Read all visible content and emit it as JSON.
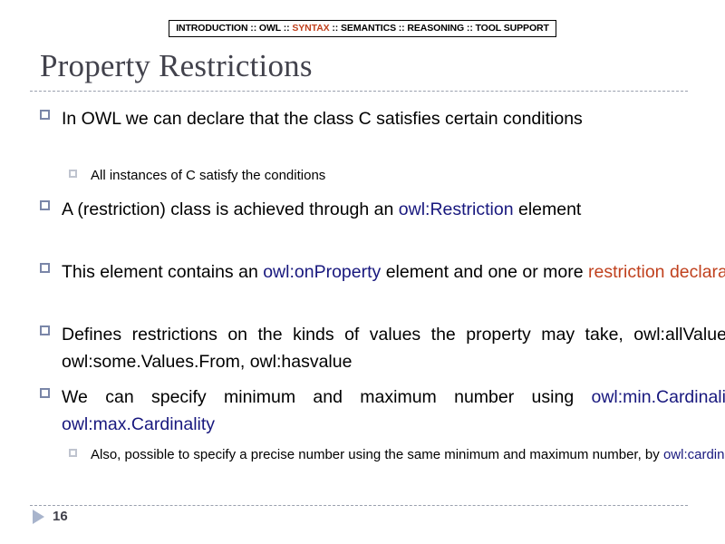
{
  "nav": {
    "items": [
      {
        "label": "INTRODUCTION",
        "highlight": false
      },
      {
        "label": "OWL",
        "highlight": false
      },
      {
        "label": "SYNTAX",
        "highlight": true
      },
      {
        "label": "SEMANTICS",
        "highlight": false
      },
      {
        "label": "REASONING",
        "highlight": false
      },
      {
        "label": "TOOL SUPPORT",
        "highlight": false
      }
    ],
    "separator": "::",
    "highlight_color": "#C0411E",
    "full_text": "INTRODUCTION :: OWL :: SYNTAX :: SEMANTICS :: REASONING :: TOOL SUPPORT"
  },
  "title": "Property Restrictions",
  "colors": {
    "title": "#42424C",
    "accent_blue": "#18187E",
    "accent_red": "#C0411E",
    "bullet_level1": "#7A86A8",
    "bullet_level2": "#BFC4CF",
    "rule": "#9AA0AE"
  },
  "bullets": [
    {
      "level": 1,
      "bullet_glyph": "hollow-square",
      "runs": [
        {
          "text": "In OWL we can declare that the class C satisfies certain conditions",
          "color": "black"
        }
      ]
    },
    {
      "level": 2,
      "bullet_glyph": "hollow-square",
      "runs": [
        {
          "text": "All instances of C satisfy the conditions",
          "color": "black"
        }
      ]
    },
    {
      "level": 1,
      "bullet_glyph": "hollow-square",
      "runs": [
        {
          "text": "A (restriction) class is achieved through an ",
          "color": "black"
        },
        {
          "text": "owl:Restriction",
          "color": "blue"
        },
        {
          "text": " element",
          "color": "black"
        }
      ]
    },
    {
      "level": 1,
      "bullet_glyph": "hollow-square",
      "runs": [
        {
          "text": "This element contains an ",
          "color": "black"
        },
        {
          "text": "owl:onProperty",
          "color": "blue"
        },
        {
          "text": " element and one or more ",
          "color": "black"
        },
        {
          "text": "restriction declarations",
          "color": "red"
        }
      ]
    },
    {
      "level": 1,
      "bullet_glyph": "hollow-square",
      "runs": [
        {
          "text": "Defines restrictions on the kinds of values the property may take, owl:allValues.From, owl:some.Values.From, owl:hasvalue",
          "color": "black"
        }
      ]
    },
    {
      "level": 1,
      "bullet_glyph": "hollow-square",
      "runs": [
        {
          "text": "We can specify minimum and maximum number using ",
          "color": "black"
        },
        {
          "text": "owl:min.Cardinality",
          "color": "blue"
        },
        {
          "text": " and ",
          "color": "black"
        },
        {
          "text": "owl:max.Cardinality",
          "color": "blue"
        }
      ]
    },
    {
      "level": 2,
      "bullet_glyph": "hollow-square",
      "runs": [
        {
          "text": "Also, possible to specify a precise number using the same minimum and maximum number,  by ",
          "color": "black"
        },
        {
          "text": "owl:cardinality",
          "color": "blue"
        }
      ]
    }
  ],
  "footer": {
    "page_number": "16",
    "marker_icon": "triangle-right-icon"
  }
}
